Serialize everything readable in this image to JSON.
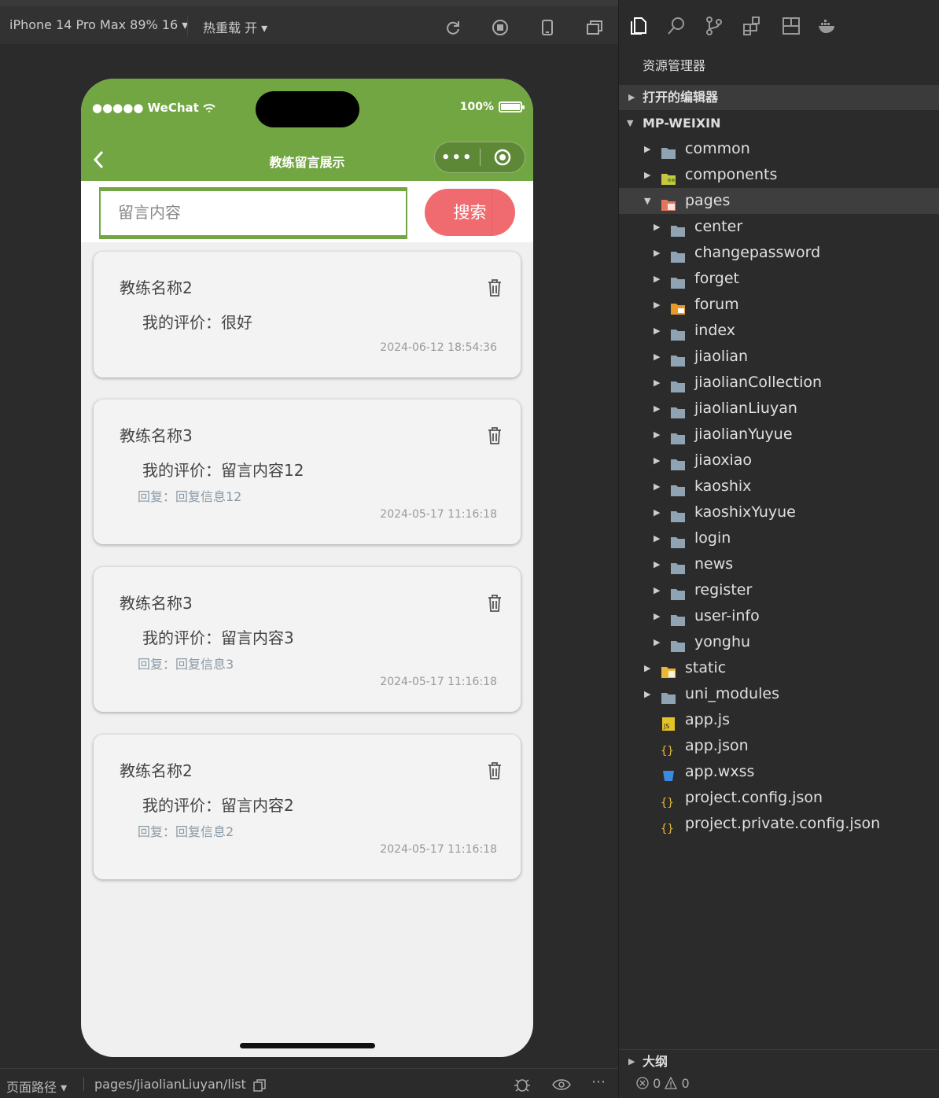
{
  "toolbar": {
    "device": "iPhone 14 Pro Max 89% 16 ▾",
    "hot_reload": "热重载 开 ▾",
    "icons": [
      "refresh-icon",
      "stop-icon",
      "phone-icon",
      "window-icon"
    ]
  },
  "phone": {
    "status": {
      "carrier": "●●●●● WeChat",
      "battery": "100%"
    },
    "nav_title": "教练留言展示",
    "capsule_more": "•••",
    "search": {
      "placeholder": "留言内容",
      "button": "搜索"
    },
    "cards": [
      {
        "name": "教练名称2",
        "message": "我的评价：很好",
        "reply": "",
        "time": "2024-06-12 18:54:36"
      },
      {
        "name": "教练名称3",
        "message": "我的评价：留言内容12",
        "reply": "回复：回复信息12",
        "time": "2024-05-17 11:16:18"
      },
      {
        "name": "教练名称3",
        "message": "我的评价：留言内容3",
        "reply": "回复：回复信息3",
        "time": "2024-05-17 11:16:18"
      },
      {
        "name": "教练名称2",
        "message": "我的评价：留言内容2",
        "reply": "回复：回复信息2",
        "time": "2024-05-17 11:16:18"
      }
    ]
  },
  "bottombar": {
    "label": "页面路径 ▾",
    "path": "pages/jiaolianLiuyan/list"
  },
  "explorer": {
    "title": "资源管理器",
    "open_editors": "打开的编辑器",
    "project": "MP-WEIXIN",
    "tree": [
      {
        "label": "common",
        "level": 1,
        "icon": "folder-icon",
        "arrow": "▶"
      },
      {
        "label": "components",
        "level": 1,
        "icon": "components-folder-icon",
        "arrow": "▶"
      },
      {
        "label": "pages",
        "level": 1,
        "icon": "pages-folder-icon",
        "arrow": "▼",
        "selected": true
      },
      {
        "label": "center",
        "level": 2,
        "icon": "folder-icon",
        "arrow": "▶"
      },
      {
        "label": "changepassword",
        "level": 2,
        "icon": "folder-icon",
        "arrow": "▶"
      },
      {
        "label": "forget",
        "level": 2,
        "icon": "folder-icon",
        "arrow": "▶"
      },
      {
        "label": "forum",
        "level": 2,
        "icon": "forum-folder-icon",
        "arrow": "▶"
      },
      {
        "label": "index",
        "level": 2,
        "icon": "folder-icon",
        "arrow": "▶"
      },
      {
        "label": "jiaolian",
        "level": 2,
        "icon": "folder-icon",
        "arrow": "▶"
      },
      {
        "label": "jiaolianCollection",
        "level": 2,
        "icon": "folder-icon",
        "arrow": "▶"
      },
      {
        "label": "jiaolianLiuyan",
        "level": 2,
        "icon": "folder-icon",
        "arrow": "▶"
      },
      {
        "label": "jiaolianYuyue",
        "level": 2,
        "icon": "folder-icon",
        "arrow": "▶"
      },
      {
        "label": "jiaoxiao",
        "level": 2,
        "icon": "folder-icon",
        "arrow": "▶"
      },
      {
        "label": "kaoshix",
        "level": 2,
        "icon": "folder-icon",
        "arrow": "▶"
      },
      {
        "label": "kaoshixYuyue",
        "level": 2,
        "icon": "folder-icon",
        "arrow": "▶"
      },
      {
        "label": "login",
        "level": 2,
        "icon": "folder-icon",
        "arrow": "▶"
      },
      {
        "label": "news",
        "level": 2,
        "icon": "folder-icon",
        "arrow": "▶"
      },
      {
        "label": "register",
        "level": 2,
        "icon": "folder-icon",
        "arrow": "▶"
      },
      {
        "label": "user-info",
        "level": 2,
        "icon": "folder-icon",
        "arrow": "▶"
      },
      {
        "label": "yonghu",
        "level": 2,
        "icon": "folder-icon",
        "arrow": "▶"
      },
      {
        "label": "static",
        "level": 1,
        "icon": "static-folder-icon",
        "arrow": "▶"
      },
      {
        "label": "uni_modules",
        "level": 1,
        "icon": "folder-icon",
        "arrow": "▶"
      },
      {
        "label": "app.js",
        "level": 1,
        "icon": "js-file-icon",
        "arrow": ""
      },
      {
        "label": "app.json",
        "level": 1,
        "icon": "json-file-icon",
        "arrow": ""
      },
      {
        "label": "app.wxss",
        "level": 1,
        "icon": "css-file-icon",
        "arrow": ""
      },
      {
        "label": "project.config.json",
        "level": 1,
        "icon": "json-file-icon",
        "arrow": ""
      },
      {
        "label": "project.private.config.json",
        "level": 1,
        "icon": "json-file-icon",
        "arrow": ""
      }
    ],
    "outline": "大纲",
    "status": {
      "errors": "0",
      "warnings": "0"
    }
  },
  "colors": {
    "brand": "#72a642",
    "search_button": "#f06b6f"
  }
}
